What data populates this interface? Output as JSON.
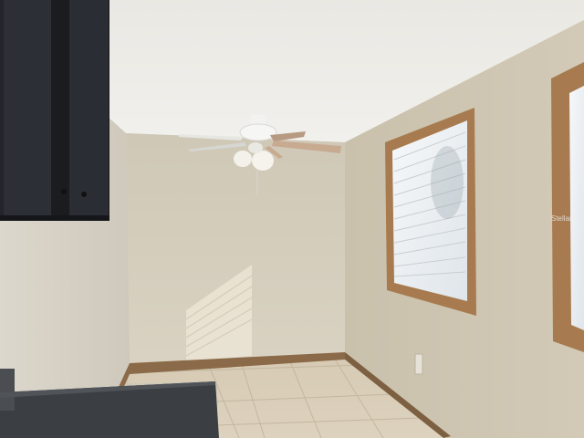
{
  "scene": {
    "description_kind": "photo",
    "watermark_text": "Stellar",
    "colors": {
      "ceiling": "#ecebe6",
      "back_wall": "#d3ccbb",
      "right_wall": "#cbc3ae",
      "left_wall": "#d8d2c6",
      "floor_tile": "#d9cdb8",
      "baseboard": "#8a6a48",
      "cabinet": "#23252a",
      "countertop": "#3b3e42",
      "window_frame": "#a77b4f",
      "blinds": "#eef0f2"
    }
  }
}
